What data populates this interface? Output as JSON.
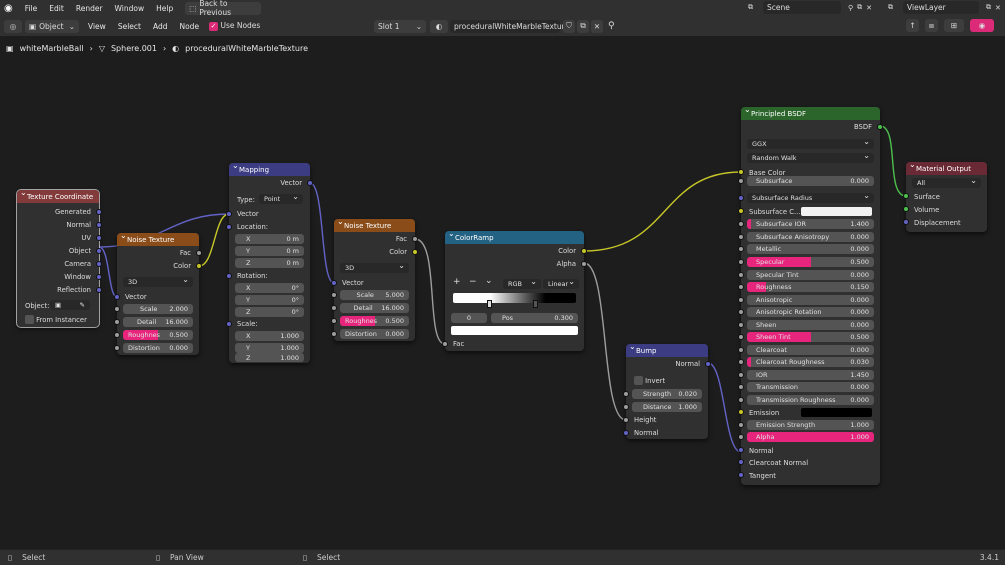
{
  "menu": [
    "File",
    "Edit",
    "Render",
    "Window",
    "Help"
  ],
  "back_button": "Back to Previous",
  "scene": "Scene",
  "view_layer": "ViewLayer",
  "header": {
    "mode": "Object",
    "menus": [
      "View",
      "Select",
      "Add",
      "Node"
    ],
    "use_nodes": "Use Nodes",
    "slot": "Slot 1",
    "material": "proceduralWhiteMarbleTexture"
  },
  "breadcrumb": [
    "whiteMarbleBall",
    "Sphere.001",
    "proceduralWhiteMarbleTexture"
  ],
  "status": {
    "left": "Select",
    "mid": "Pan View",
    "right": "Select",
    "version": "3.4.1"
  },
  "colors": {
    "input": "#833a3a",
    "texture": "#8a4d1a",
    "vector": "#3c3c83",
    "converter": "#246283",
    "shader": "#2b652b",
    "output": "#6a2a35",
    "accent": "#e8257d"
  },
  "nodes": {
    "texcoord": {
      "title": "Texture Coordinate",
      "outputs": [
        "Generated",
        "Normal",
        "UV",
        "Object",
        "Camera",
        "Window",
        "Reflection"
      ],
      "object_label": "Object:",
      "from_instancer": "From Instancer"
    },
    "noise1": {
      "title": "Noise Texture",
      "outputs": [
        "Fac",
        "Color"
      ],
      "dim": "3D",
      "vector": "Vector",
      "fields": [
        {
          "l": "Scale",
          "v": "2.000"
        },
        {
          "l": "Detail",
          "v": "16.000"
        },
        {
          "l": "Roughnes",
          "v": "0.500"
        },
        {
          "l": "Distortion",
          "v": "0.000"
        }
      ]
    },
    "mapping": {
      "title": "Mapping",
      "output": "Vector",
      "type_label": "Type:",
      "type": "Point",
      "vector": "Vector",
      "location": "Location:",
      "rotation": "Rotation:",
      "scale": "Scale:",
      "loc": [
        {
          "l": "X",
          "v": "0 m"
        },
        {
          "l": "Y",
          "v": "0 m"
        },
        {
          "l": "Z",
          "v": "0 m"
        }
      ],
      "rot": [
        {
          "l": "X",
          "v": "0°"
        },
        {
          "l": "Y",
          "v": "0°"
        },
        {
          "l": "Z",
          "v": "0°"
        }
      ],
      "scl": [
        {
          "l": "X",
          "v": "1.000"
        },
        {
          "l": "Y",
          "v": "1.000"
        },
        {
          "l": "Z",
          "v": "1.000"
        }
      ]
    },
    "noise2": {
      "title": "Noise Texture",
      "outputs": [
        "Fac",
        "Color"
      ],
      "dim": "3D",
      "vector": "Vector",
      "fields": [
        {
          "l": "Scale",
          "v": "5.000"
        },
        {
          "l": "Detail",
          "v": "16.000"
        },
        {
          "l": "Roughnes",
          "v": "0.500"
        },
        {
          "l": "Distortion",
          "v": "0.000"
        }
      ]
    },
    "colorramp": {
      "title": "ColorRamp",
      "outputs": [
        "Color",
        "Alpha"
      ],
      "color_mode": "RGB",
      "interp": "Linear",
      "index": "0",
      "pos_label": "Pos",
      "pos": "0.300",
      "fac": "Fac"
    },
    "bump": {
      "title": "Bump",
      "output": "Normal",
      "invert": "Invert",
      "strength_label": "Strength",
      "strength": "0.020",
      "distance_label": "Distance",
      "distance": "1.000",
      "inputs": [
        "Height",
        "Normal"
      ]
    },
    "bsdf": {
      "title": "Principled BSDF",
      "output": "BSDF",
      "distribution": "GGX",
      "sss_method": "Random Walk",
      "base_color": "Base Color",
      "subsurface_radius": "Subsurface Radius",
      "subsurface_color": "Subsurface C...",
      "emission": "Emission",
      "bottom": [
        "Normal",
        "Clearcoat Normal",
        "Tangent"
      ],
      "fields": [
        {
          "l": "Subsurface",
          "v": "0.000"
        },
        {
          "l": "Subsurface IOR",
          "v": "1.400"
        },
        {
          "l": "Subsurface Anisotropy",
          "v": "0.000"
        },
        {
          "l": "Metallic",
          "v": "0.000"
        },
        {
          "l": "Specular",
          "v": "0.500"
        },
        {
          "l": "Specular Tint",
          "v": "0.000"
        },
        {
          "l": "Roughness",
          "v": "0.150"
        },
        {
          "l": "Anisotropic",
          "v": "0.000"
        },
        {
          "l": "Anisotropic Rotation",
          "v": "0.000"
        },
        {
          "l": "Sheen",
          "v": "0.000"
        },
        {
          "l": "Sheen Tint",
          "v": "0.500"
        },
        {
          "l": "Clearcoat",
          "v": "0.000"
        },
        {
          "l": "Clearcoat Roughness",
          "v": "0.030"
        },
        {
          "l": "IOR",
          "v": "1.450"
        },
        {
          "l": "Transmission",
          "v": "0.000"
        },
        {
          "l": "Transmission Roughness",
          "v": "0.000"
        }
      ],
      "emission_strength": {
        "l": "Emission Strength",
        "v": "1.000"
      },
      "alpha": {
        "l": "Alpha",
        "v": "1.000"
      }
    },
    "output": {
      "title": "Material Output",
      "target": "All",
      "inputs": [
        "Surface",
        "Volume",
        "Displacement"
      ]
    }
  }
}
